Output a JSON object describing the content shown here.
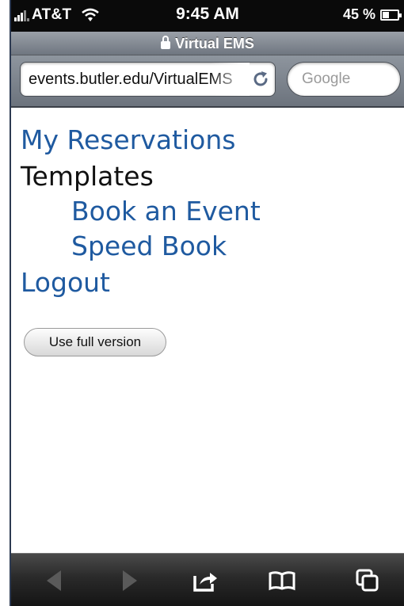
{
  "status_bar": {
    "carrier": "AT&T",
    "time": "9:45 AM",
    "battery_text": "45 %",
    "battery_level": 0.45
  },
  "browser": {
    "page_title": "Virtual EMS",
    "url_text": "events.butler.edu/VirtualEMS",
    "search_placeholder": "Google"
  },
  "menu": {
    "my_reservations": "My Reservations",
    "templates": "Templates",
    "book_an_event": "Book an Event",
    "speed_book": "Speed Book",
    "logout": "Logout"
  },
  "actions": {
    "full_version_label": "Use full version"
  },
  "toolbar": {
    "icons": [
      "back-arrow-icon",
      "forward-arrow-icon",
      "share-icon",
      "bookmarks-icon",
      "tabs-icon"
    ]
  },
  "colors": {
    "link": "#1f5aa0",
    "text": "#111111",
    "status_bar_bg": "#0a0a0a",
    "toolbar_bg": "#2a2a2a"
  }
}
